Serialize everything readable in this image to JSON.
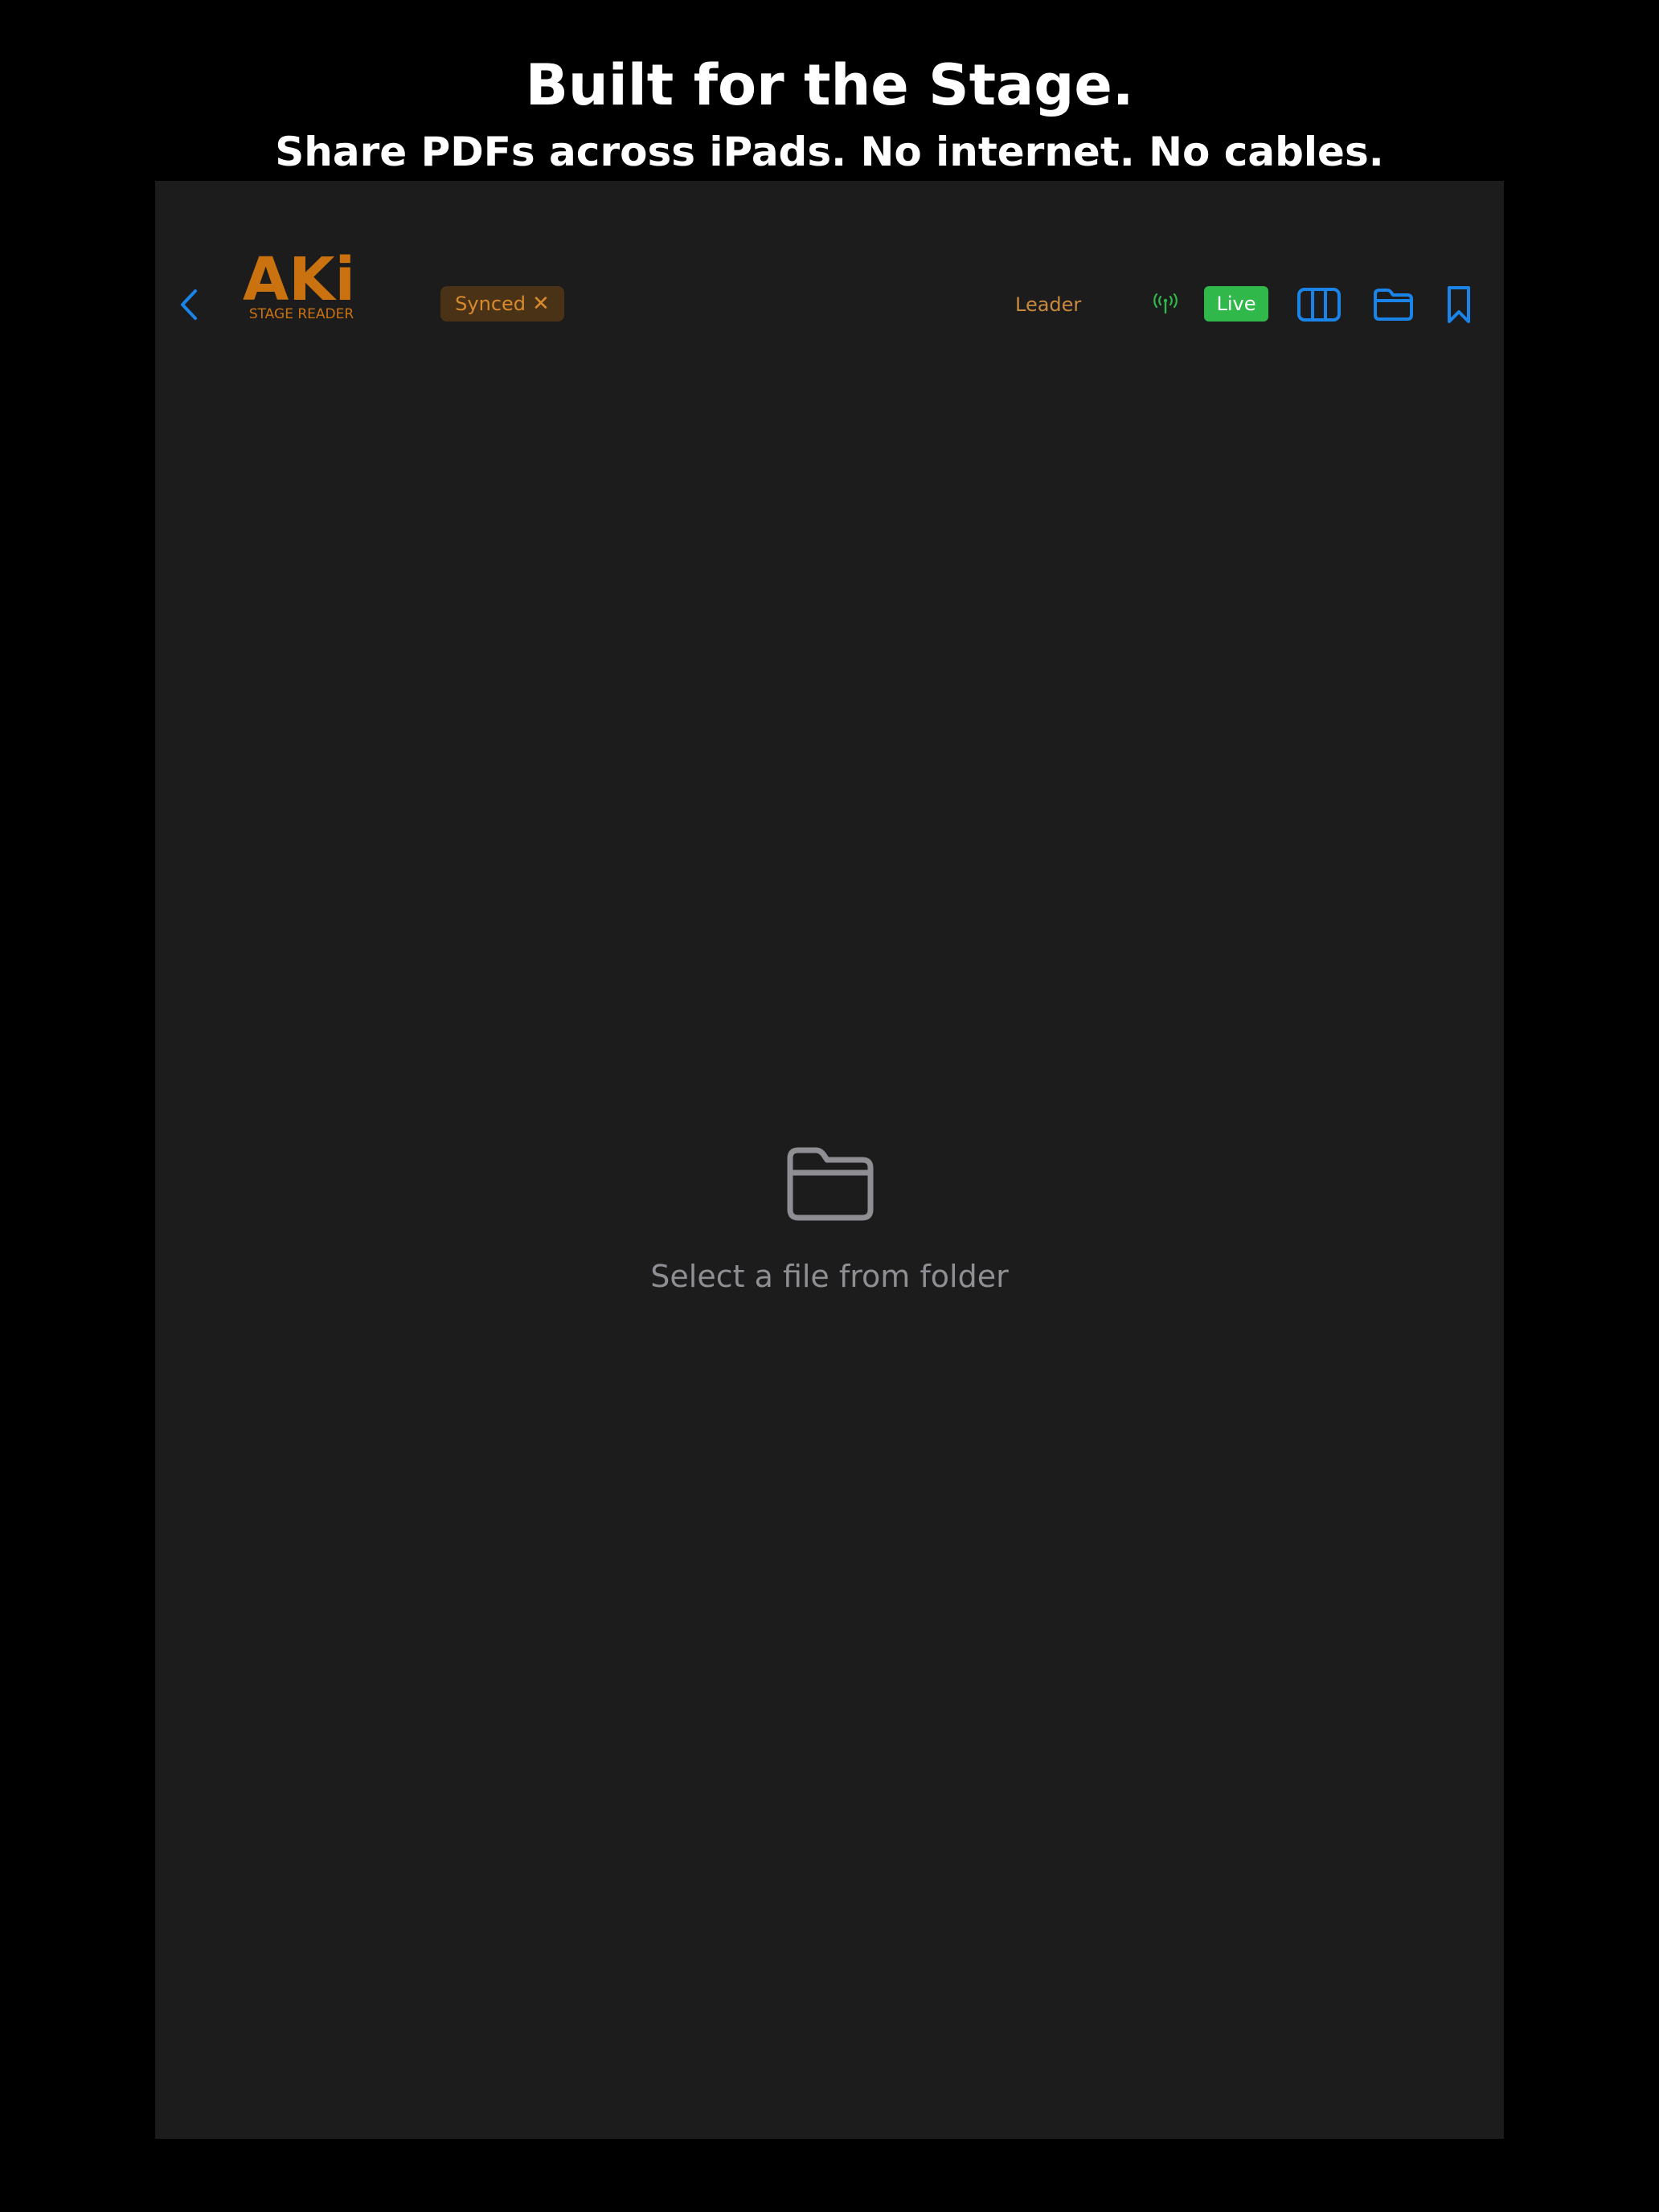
{
  "promo": {
    "title": "Built for the Stage.",
    "subtitle": "Share PDFs across iPads. No internet. No cables."
  },
  "toolbar": {
    "back_icon": "chevron-left-icon",
    "logo": {
      "text": "AKi",
      "tagline": "STAGE READER",
      "color": "#c9720f"
    },
    "synced_label": "Synced",
    "synced_close": "✕",
    "role_label": "Leader",
    "signal_icon": "antenna-signal-icon",
    "live_label": "Live",
    "columns_icon": "columns-icon",
    "folder_icon": "folder-icon",
    "bookmark_icon": "bookmark-icon"
  },
  "empty_state": {
    "icon": "folder-icon",
    "message": "Select a file from folder"
  },
  "colors": {
    "accent_blue": "#1a84e8",
    "live_green": "#30b84a",
    "synced_bg": "#4a3216",
    "synced_text": "#d98a2c",
    "screen_bg": "#1c1c1c",
    "muted_text": "#8e8e93"
  }
}
